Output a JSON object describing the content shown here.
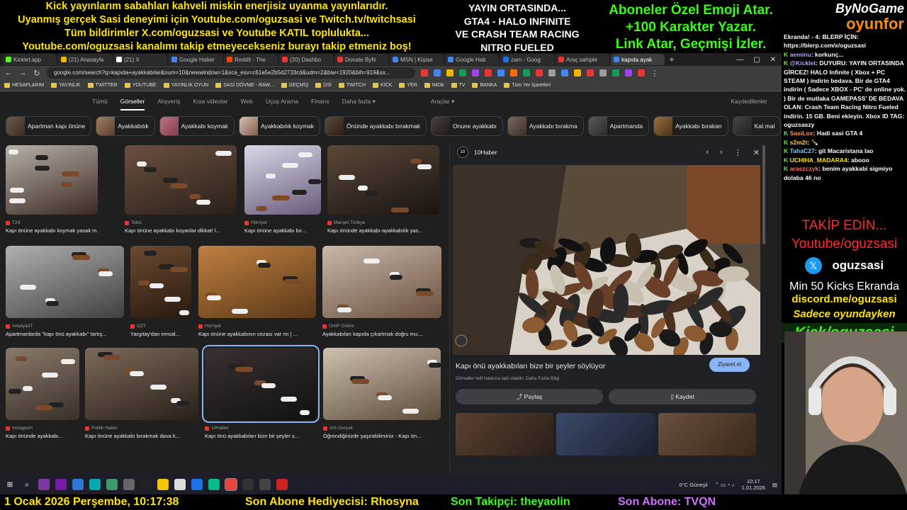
{
  "overlay": {
    "left_lines": [
      "Kick yayınlarım sabahları kahveli miskin enerjisiz uyanma yayınlarıdır.",
      "Uyanmış gerçek Sasi deneyimi için Youtube.com/oguzsasi ve Twitch.tv/twitchsasi",
      "Tüm bildirimler X.com/oguzsasi ve Youtube KATIL toplulukta...",
      "Youtube.com/oguzsasi kanalımı takip etmeyecekseniz burayı takip etmeniz boş!"
    ],
    "mid_lines": [
      "YAYIN ORTASINDA...",
      "GTA4 - HALO INFINITE",
      "VE CRASH TEAM RACING",
      "NITRO FUELED"
    ],
    "right_lines": [
      "Aboneler Özel Emoji Atar.",
      "+100 Karakter Yazar.",
      "Link Atar, Geçmişi İzler."
    ],
    "brand_top": "ByNoGame",
    "brand_bottom": "oyunfor",
    "bottom": {
      "date": "1 Ocak 2026 Perşembe, 10:17:38",
      "gift": "Son Abone Hediyecisi: Rhosyna",
      "follower": "Son Takipçi: theyaolin",
      "sub": "Son Abone: TVQN"
    }
  },
  "browser": {
    "tabs": [
      {
        "label": "Kicklet.app",
        "active": false
      },
      {
        "label": "(21) Anasayfa",
        "active": false
      },
      {
        "label": "(21) X",
        "active": false
      },
      {
        "label": "Google Haber",
        "active": false
      },
      {
        "label": "Reddit - The",
        "active": false
      },
      {
        "label": "(20) Dashbo",
        "active": false
      },
      {
        "label": "Donate ByN",
        "active": false
      },
      {
        "label": "MSN | Kişise",
        "active": false
      },
      {
        "label": "Google Hab",
        "active": false
      },
      {
        "label": "zam - Goog",
        "active": false
      },
      {
        "label": "Araç sahiple",
        "active": false
      },
      {
        "label": "kapıda ayak",
        "active": true
      }
    ],
    "url": "google.com/search?q=kapıda+ayakkabılar&num=10&newwindow=1&sca_esv=c61a5e2b5d2733cd&udm=2&biw=1920&bih=919&sx...",
    "bookmarks": [
      "HESAPLARIM",
      "YAYINLIK",
      "TWITTER",
      "YOUTUBE",
      "YAYINLIK OYUN",
      "SASİ DÖVME - RAW...",
      "GEÇMİŞ",
      "DSİ",
      "TWITCH",
      "KICK",
      "YER",
      "IMDb",
      "TV",
      "BANKA",
      "Tüm Yer İşaretleri"
    ],
    "google_tabs": [
      "Tümü",
      "Görseller",
      "Alışveriş",
      "Kısa videolar",
      "Web",
      "Uçuş Arama",
      "Finans",
      "Daha fazla ▾",
      "Araçlar ▾"
    ],
    "saved_label": "Kaydedilenler",
    "chips": [
      "Apartman kapı önüne",
      "Ayakkabılık",
      "Ayakkabı koymak",
      "Ayakkabılık koymak",
      "Önünde ayakkabı bırakmak",
      "Onune ayakkabı",
      "Ayakkabı bırakma",
      "Apartmanda",
      "Ayakkabı bırakan",
      "Kat mal"
    ],
    "results": [
      {
        "src": "T24",
        "title": "Kapı önüne ayakkabı koymak yasak m..."
      },
      {
        "src": "Tele1",
        "title": "Kapı önüne ayakkabı koyanlar dikkat! İ..."
      },
      {
        "src": "Hürriyet",
        "title": "Kapı önüne ayakkabı bır..."
      },
      {
        "src": "Manşet Türkiye",
        "title": "Kapı önünde ayakkabı-ayakkabılık yas..."
      },
      {
        "src": "Antalya3T",
        "title": "Apartmanlarda \"kapı önü ayakkabı\" tartış..."
      },
      {
        "src": "GZT",
        "title": "Yargıtay'dan emsal..."
      },
      {
        "src": "Hürriyet",
        "title": "Kapı önüne ayakkabının cezası var mı | ..."
      },
      {
        "src": "CHIP Online",
        "title": "Ayakkabıları kapıda çıkartmak doğru mu,..."
      },
      {
        "src": "Instagram",
        "title": "Kapı önünde ayakkabı..."
      },
      {
        "src": "Politik Haber",
        "title": "Kapı önüne ayakkabı bırakmak dava k..."
      },
      {
        "src": "10Haber",
        "title": "Kapı önü ayakkabıları bize bir şeyler s..."
      },
      {
        "src": "Artı Gerçek",
        "title": "Öğrendiğinizde şaşırabilirsiniz - Kapı ön..."
      }
    ],
    "panel": {
      "source": "10Haber",
      "logo_text": "10",
      "title": "Kapı önü ayakkabıları bize bir şeyler söylüyor",
      "visit": "Ziyaret et",
      "note": "Görseller telif hakkına tabi olabilir. Daha Fazla Bilgi",
      "share": "Paylaş",
      "save": "Kaydet"
    }
  },
  "taskbar": {
    "weather": "0°C  Güneşli",
    "time": "10:17",
    "date": "1.01.2026"
  },
  "chat": {
    "messages": [
      {
        "user": "",
        "text": "Ekranda! - 4: BLERP İÇİN: https://blerp.com/x/oguzsasi"
      },
      {
        "user": "aeminu",
        "text": ": korkunç..."
      },
      {
        "user": "@Kicklet",
        "text": ": DUYURU: YAYIN ORTASINDA GİRCEZ! HALO Infinite ( Xbox + PC STEAM ) indirin bedava. Bir de GTA4 indirin ( Sadece XBOX - PC' de online yok. ) Bir de mutlaka GAMEPASS' DE BEDAVA OLAN: Crash Team Racing Nitro Fueled indirin. 15 GB. Beni ekleyin. Xbox ID TAG: oguzsaszy"
      },
      {
        "user": "SasiLox",
        "text": ": Hadi sasi GTA 4"
      },
      {
        "user": "s2m2t",
        "text": ": 🍾"
      },
      {
        "user": "TahaC27",
        "text": ": git Macaristana lao"
      },
      {
        "user": "UCHIHA_MADARA4",
        "text": ": abooo"
      },
      {
        "user": "araszczyk",
        "text": ": benim ayakkabi sigmiyo dolaba 46 no"
      }
    ],
    "promo": {
      "follow": "TAKİP EDİN...",
      "youtube": "Youtube/oguzsasi",
      "x_handle": "oguzsasi",
      "kicks": "Min 50 Kicks Ekranda",
      "discord": "discord.me/oguzsasi",
      "only_game": "Sadece oyundayken",
      "kick": "Kick/oguzsasi"
    }
  },
  "colors": {
    "yellow": "#ffe600",
    "green": "#39ff14",
    "kick_green": "#53fc18",
    "accent_blue": "#8ab4f8"
  }
}
